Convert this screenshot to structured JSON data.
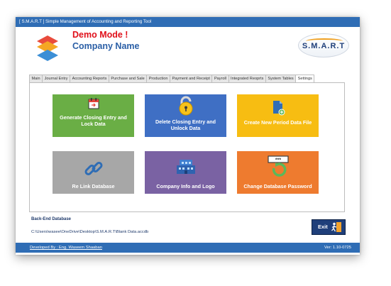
{
  "window": {
    "title": "[ S.M.A.R.T ] Simple Management of Accounting and Reporting Tool"
  },
  "header": {
    "demo_mode": "Demo Mode !",
    "company_name": "Company Name",
    "brand": "S.M.A.R.T"
  },
  "tabs": [
    {
      "label": "Main"
    },
    {
      "label": "Journal Entry"
    },
    {
      "label": "Accounting Reports"
    },
    {
      "label": "Purchase and Sale"
    },
    {
      "label": "Production"
    },
    {
      "label": "Payment and Receipt"
    },
    {
      "label": "Payroll"
    },
    {
      "label": "Integrated Reoprts"
    },
    {
      "label": "System Tables"
    },
    {
      "label": "Settings",
      "active": true
    }
  ],
  "tiles": {
    "generate": {
      "label": "Generate Closing Entry and Lock Data",
      "icon": "calendar-icon",
      "color": "#6aae45"
    },
    "delete": {
      "label": "Delete Closing Entry and Unlock Data",
      "icon": "unlock-icon",
      "color": "#3f6fc4"
    },
    "new_period": {
      "label": "Create New Period Data File",
      "icon": "new-file-icon",
      "color": "#f7bd12"
    },
    "relink": {
      "label": "Re Link Database",
      "icon": "link-icon",
      "color": "#a7a7a7"
    },
    "company_info": {
      "label": "Company Info and Logo",
      "icon": "building-icon",
      "color": "#7a62a3"
    },
    "db_password": {
      "label": "Change Database Password",
      "icon": "password-icon",
      "color": "#ee7b2f"
    }
  },
  "backend": {
    "title": "Back-End Database",
    "path": "C:\\Users\\wasee\\OneDrive\\Desktop\\S.M.A.R.T\\Blank Data.accdb"
  },
  "exit": {
    "label": "Exit"
  },
  "footer": {
    "developer": "Developed By : Eng. Waseem Shaaban",
    "version": "Ver: 1.10-0725"
  }
}
